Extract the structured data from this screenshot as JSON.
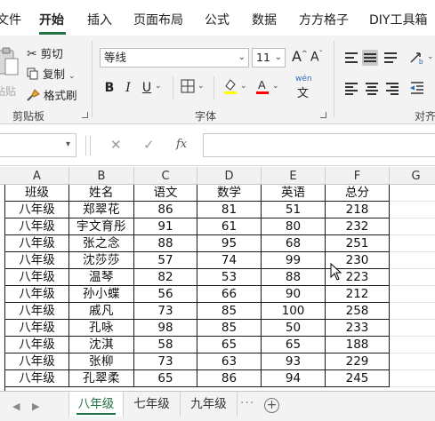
{
  "menu": {
    "tabs": [
      {
        "label": "文件",
        "active": false
      },
      {
        "label": "开始",
        "active": true
      },
      {
        "label": "插入",
        "active": false
      },
      {
        "label": "页面布局",
        "active": false
      },
      {
        "label": "公式",
        "active": false
      },
      {
        "label": "数据",
        "active": false
      },
      {
        "label": "方方格子",
        "active": false
      },
      {
        "label": "DIY工具箱",
        "active": false
      }
    ]
  },
  "ribbon": {
    "clipboard": {
      "paste_label": "粘贴",
      "cut_label": "剪切",
      "copy_label": "复制",
      "format_painter_label": "格式刷",
      "group_label": "剪贴板"
    },
    "font": {
      "font_name": "等线",
      "font_size": "11",
      "grow_label": "A",
      "shrink_label": "A",
      "bold_label": "B",
      "italic_label": "I",
      "underline_label": "U",
      "phonetic_label": "wén",
      "group_label": "字体",
      "highlight_color": "#ffff00",
      "font_color": "#ff0000"
    },
    "alignment": {
      "group_label": "对齐"
    }
  },
  "formula_bar": {
    "name_box": "",
    "cancel_symbol": "✕",
    "enter_symbol": "✓",
    "fx_label": "fx",
    "formula": ""
  },
  "grid": {
    "columns": [
      "A",
      "B",
      "C",
      "D",
      "E",
      "F",
      "G"
    ],
    "rows": [
      [
        "班级",
        "姓名",
        "语文",
        "数学",
        "英语",
        "总分"
      ],
      [
        "八年级",
        "郑翠花",
        "86",
        "81",
        "51",
        "218"
      ],
      [
        "八年级",
        "宇文育彤",
        "91",
        "61",
        "80",
        "232"
      ],
      [
        "八年级",
        "张之念",
        "88",
        "95",
        "68",
        "251"
      ],
      [
        "八年级",
        "沈莎莎",
        "57",
        "74",
        "99",
        "230"
      ],
      [
        "八年级",
        "温琴",
        "82",
        "53",
        "88",
        "223"
      ],
      [
        "八年级",
        "孙小蝶",
        "56",
        "66",
        "90",
        "212"
      ],
      [
        "八年级",
        "戚凡",
        "73",
        "85",
        "100",
        "258"
      ],
      [
        "八年级",
        "孔咏",
        "98",
        "85",
        "50",
        "233"
      ],
      [
        "八年级",
        "沈淇",
        "58",
        "65",
        "65",
        "188"
      ],
      [
        "八年级",
        "张柳",
        "73",
        "63",
        "93",
        "229"
      ],
      [
        "八年级",
        "孔翠柔",
        "65",
        "86",
        "94",
        "245"
      ]
    ]
  },
  "sheets": {
    "tabs": [
      {
        "label": "八年级",
        "active": true
      },
      {
        "label": "七年级",
        "active": false
      },
      {
        "label": "九年级",
        "active": false
      }
    ],
    "more_label": "···",
    "add_label": "+"
  },
  "theme": {
    "accent": "#217346"
  }
}
